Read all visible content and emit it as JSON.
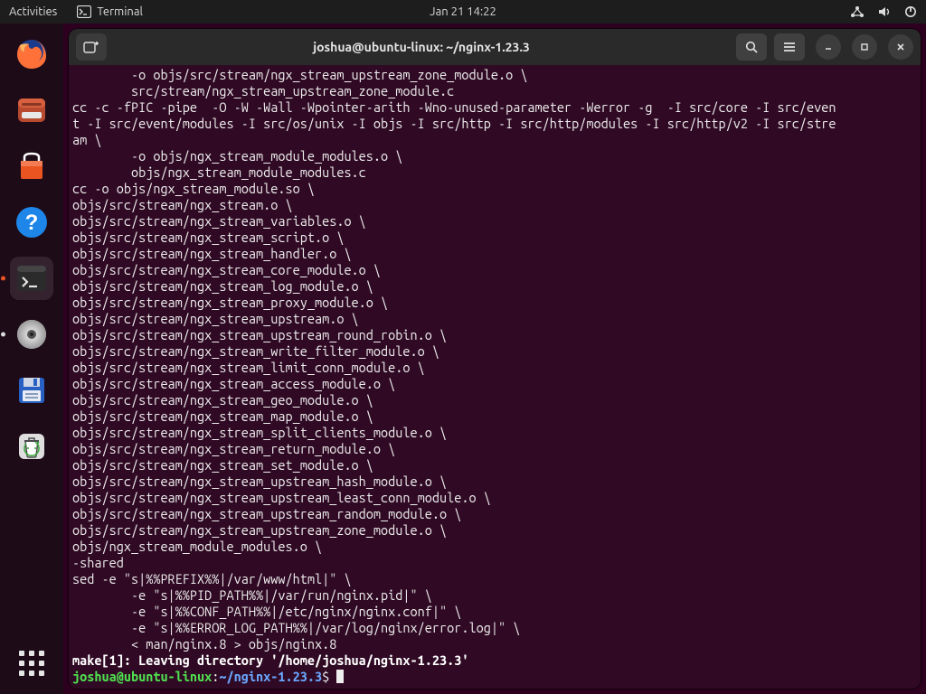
{
  "topbar": {
    "activities": "Activities",
    "app_name": "Terminal",
    "clock": "Jan 21  14:22"
  },
  "dock": {
    "items": [
      {
        "name": "firefox"
      },
      {
        "name": "files"
      },
      {
        "name": "software"
      },
      {
        "name": "help"
      },
      {
        "name": "terminal"
      },
      {
        "name": "disks"
      },
      {
        "name": "save"
      },
      {
        "name": "trash"
      }
    ]
  },
  "window": {
    "title": "joshua@ubuntu-linux: ~/nginx-1.23.3"
  },
  "terminal": {
    "lines": [
      "        -o objs/src/stream/ngx_stream_upstream_zone_module.o \\",
      "        src/stream/ngx_stream_upstream_zone_module.c",
      "cc -c -fPIC -pipe  -O -W -Wall -Wpointer-arith -Wno-unused-parameter -Werror -g  -I src/core -I src/even",
      "t -I src/event/modules -I src/os/unix -I objs -I src/http -I src/http/modules -I src/http/v2 -I src/stre",
      "am \\",
      "        -o objs/ngx_stream_module_modules.o \\",
      "        objs/ngx_stream_module_modules.c",
      "cc -o objs/ngx_stream_module.so \\",
      "objs/src/stream/ngx_stream.o \\",
      "objs/src/stream/ngx_stream_variables.o \\",
      "objs/src/stream/ngx_stream_script.o \\",
      "objs/src/stream/ngx_stream_handler.o \\",
      "objs/src/stream/ngx_stream_core_module.o \\",
      "objs/src/stream/ngx_stream_log_module.o \\",
      "objs/src/stream/ngx_stream_proxy_module.o \\",
      "objs/src/stream/ngx_stream_upstream.o \\",
      "objs/src/stream/ngx_stream_upstream_round_robin.o \\",
      "objs/src/stream/ngx_stream_write_filter_module.o \\",
      "objs/src/stream/ngx_stream_limit_conn_module.o \\",
      "objs/src/stream/ngx_stream_access_module.o \\",
      "objs/src/stream/ngx_stream_geo_module.o \\",
      "objs/src/stream/ngx_stream_map_module.o \\",
      "objs/src/stream/ngx_stream_split_clients_module.o \\",
      "objs/src/stream/ngx_stream_return_module.o \\",
      "objs/src/stream/ngx_stream_set_module.o \\",
      "objs/src/stream/ngx_stream_upstream_hash_module.o \\",
      "objs/src/stream/ngx_stream_upstream_least_conn_module.o \\",
      "objs/src/stream/ngx_stream_upstream_random_module.o \\",
      "objs/src/stream/ngx_stream_upstream_zone_module.o \\",
      "objs/ngx_stream_module_modules.o \\",
      "-shared",
      "sed -e \"s|%%PREFIX%%|/var/www/html|\" \\",
      "        -e \"s|%%PID_PATH%%|/var/run/nginx.pid|\" \\",
      "        -e \"s|%%CONF_PATH%%|/etc/nginx/nginx.conf|\" \\",
      "        -e \"s|%%ERROR_LOG_PATH%%|/var/log/nginx/error.log|\" \\",
      "        < man/nginx.8 > objs/nginx.8"
    ],
    "make_line": "make[1]: Leaving directory '/home/joshua/nginx-1.23.3'",
    "prompt_user": "joshua@ubuntu-linux",
    "prompt_colon": ":",
    "prompt_path": "~/nginx-1.23.3",
    "prompt_dollar": "$"
  }
}
